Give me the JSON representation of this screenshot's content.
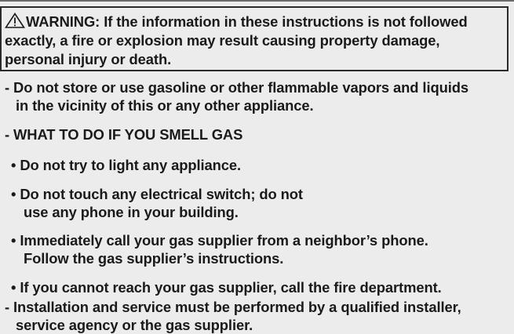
{
  "warning": {
    "icon": "warning-triangle-icon",
    "line1": "WARNING: If the information in these instructions is not followed",
    "line2": "exactly, a fire or explosion may result causing property damage,",
    "line3": "personal injury or death."
  },
  "instructions": {
    "item1_line1": "- Do not store or use gasoline or other flammable vapors and liquids",
    "item1_line2": "in the vicinity of this or any other appliance.",
    "item2_line1": "- WHAT TO DO IF YOU SMELL GAS",
    "bullets": [
      {
        "line1": "• Do not try to light any appliance.",
        "line2": ""
      },
      {
        "line1": "• Do not touch any electrical switch; do not",
        "line2": "use any phone in your building."
      },
      {
        "line1": "• Immediately call your gas supplier from a neighbor’s phone.",
        "line2": "Follow the gas supplier’s instructions."
      },
      {
        "line1": "• If you cannot reach your gas supplier, call the fire department.",
        "line2": ""
      }
    ],
    "item3_line1": "- Installation and service must be performed by a qualified installer,",
    "item3_line2": "service agency or the gas supplier."
  }
}
